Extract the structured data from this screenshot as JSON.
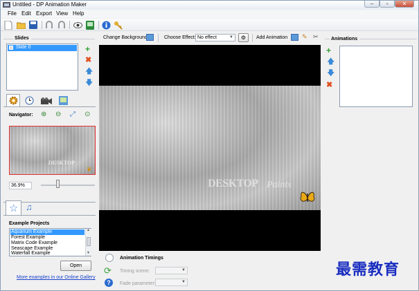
{
  "window": {
    "title": "Untitled - DP Animation Maker"
  },
  "menu": [
    "File",
    "Edit",
    "Export",
    "View",
    "Help"
  ],
  "slides": {
    "title": "Slides",
    "items": [
      "Slide 0"
    ]
  },
  "navigator": {
    "label": "Navigator:",
    "zoom": "36.9%",
    "zoom_level": 0.3
  },
  "example_projects": {
    "title": "Example Projects",
    "items": [
      "Aquarium Example",
      "Forest Example",
      "Matrix Code Example",
      "Seascape Example",
      "Waterfall Example"
    ],
    "selected": "Aquarium Example",
    "open_label": "Open",
    "gallery_link": "More examples in our Online Gallery"
  },
  "controls": {
    "change_background": "Change Background",
    "choose_effect": "Choose Effect:",
    "effect_value": "No effect",
    "add_animation": "Add Animation"
  },
  "canvas": {
    "watermark_bold": "DESKTOP",
    "watermark_script": "Paints"
  },
  "timings": {
    "title": "Animation Timings",
    "timing_scene": "Timing scene:",
    "fade_parameter": "Fade parameter:"
  },
  "animations": {
    "title": "Animations"
  },
  "overlay_text": "最需教育",
  "colors": {
    "selection": "#3399ff",
    "preview_border": "#e03030",
    "link": "#1a44cc"
  },
  "icons": [
    "app-icon",
    "new-icon",
    "open-icon",
    "save-icon",
    "undo-icon",
    "redo-icon",
    "preview-icon",
    "export-icon",
    "info-icon",
    "key-icon",
    "plus-icon",
    "delete-icon",
    "up-arrow-icon",
    "down-arrow-icon",
    "gear-icon",
    "clock-icon",
    "camera-icon",
    "image-icon",
    "zoom-in-icon",
    "zoom-out-icon",
    "fit-icon",
    "zoom-reset-icon",
    "star-icon",
    "music-icon",
    "butterfly-icon",
    "pencil-icon",
    "scissors-icon"
  ]
}
